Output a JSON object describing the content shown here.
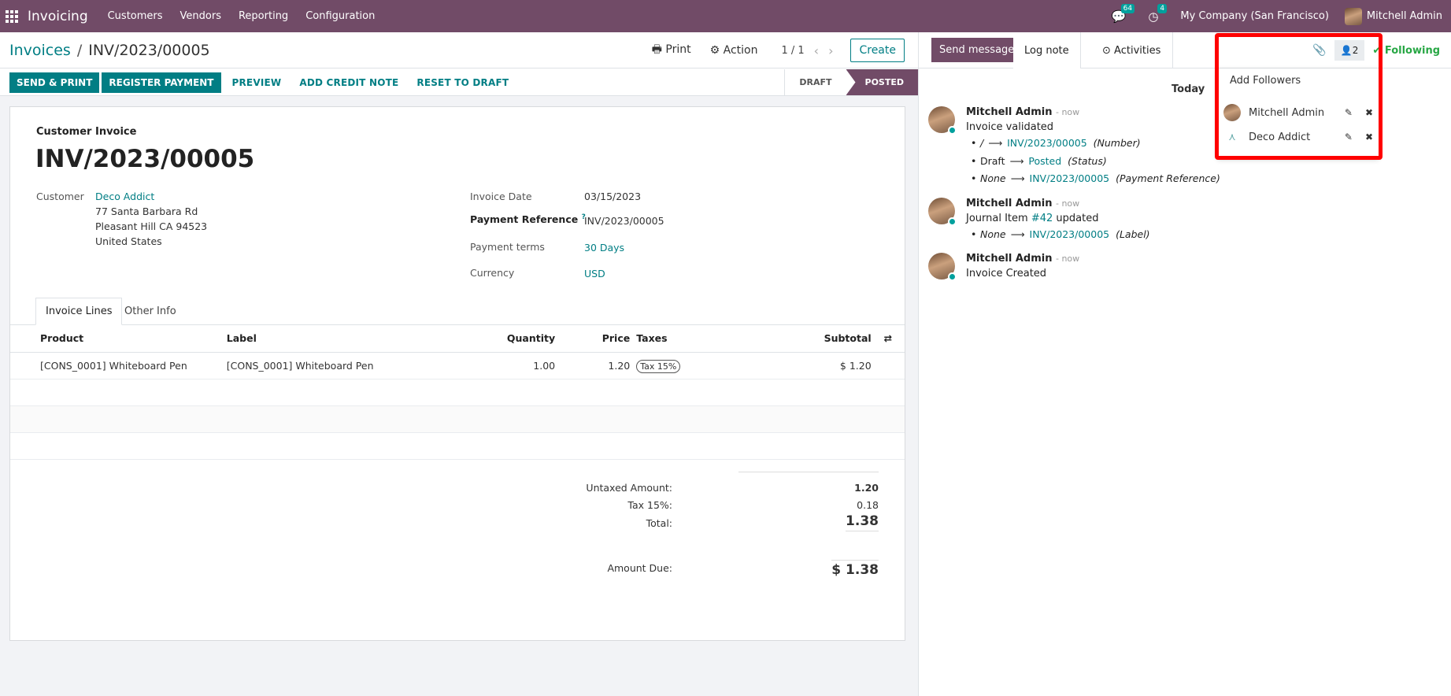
{
  "navbar": {
    "app_name": "Invoicing",
    "menu": [
      "Customers",
      "Vendors",
      "Reporting",
      "Configuration"
    ],
    "messages_count": "64",
    "activities_count": "4",
    "company": "My Company (San Francisco)",
    "user": "Mitchell Admin"
  },
  "control_panel": {
    "breadcrumb_parent": "Invoices",
    "breadcrumb_separator": "/",
    "breadcrumb_current": "INV/2023/00005",
    "print_label": "Print",
    "action_label": "Action",
    "pager": "1 / 1",
    "create_label": "Create"
  },
  "statusbar": {
    "send_print": "SEND & PRINT",
    "register_payment": "REGISTER PAYMENT",
    "preview": "PREVIEW",
    "add_credit_note": "ADD CREDIT NOTE",
    "reset_to_draft": "RESET TO DRAFT",
    "stages": [
      "DRAFT",
      "POSTED"
    ],
    "active_stage": "POSTED"
  },
  "invoice": {
    "type": "Customer Invoice",
    "number": "INV/2023/00005",
    "customer_label": "Customer",
    "customer_name": "Deco Addict",
    "address_line1": "77 Santa Barbara Rd",
    "address_line2": "Pleasant Hill CA 94523",
    "address_line3": "United States",
    "invoice_date_label": "Invoice Date",
    "invoice_date": "03/15/2023",
    "payment_ref_label": "Payment Reference",
    "payment_ref_help": "?",
    "payment_ref": "INV/2023/00005",
    "payment_terms_label": "Payment terms",
    "payment_terms": "30 Days",
    "currency_label": "Currency",
    "currency": "USD"
  },
  "tabs": {
    "invoice_lines": "Invoice Lines",
    "other_info": "Other Info"
  },
  "lines": {
    "headers": {
      "product": "Product",
      "label": "Label",
      "quantity": "Quantity",
      "price": "Price",
      "taxes": "Taxes",
      "subtotal": "Subtotal"
    },
    "rows": [
      {
        "product": "[CONS_0001] Whiteboard Pen",
        "label": "[CONS_0001] Whiteboard Pen",
        "quantity": "1.00",
        "price": "1.20",
        "tax": "Tax 15%",
        "subtotal": "$ 1.20"
      }
    ]
  },
  "totals": {
    "untaxed_label": "Untaxed Amount:",
    "untaxed": "1.20",
    "tax_label": "Tax 15%:",
    "tax": "0.18",
    "total_label": "Total:",
    "total": "1.38",
    "due_label": "Amount Due:",
    "due": "$ 1.38"
  },
  "chatter": {
    "send_message": "Send message",
    "log_note": "Log note",
    "activities": "Activities",
    "followers_count": "2",
    "following": "Following",
    "today": "Today",
    "messages": [
      {
        "author": "Mitchell Admin",
        "time": "- now",
        "body": "Invoice validated",
        "changes": [
          {
            "old": "/",
            "new": "INV/2023/00005",
            "field": "(Number)"
          },
          {
            "old": "Draft",
            "new": "Posted",
            "field": "(Status)"
          },
          {
            "old": "None",
            "new": "INV/2023/00005",
            "field": "(Payment Reference)"
          }
        ]
      },
      {
        "author": "Mitchell Admin",
        "time": "- now",
        "body_prefix": "Journal Item",
        "body_link": "#42",
        "body_suffix": "updated",
        "changes": [
          {
            "old": "None",
            "new": "INV/2023/00005",
            "field": "(Label)"
          }
        ]
      },
      {
        "author": "Mitchell Admin",
        "time": "- now",
        "body": "Invoice Created"
      }
    ]
  },
  "followers_dropdown": {
    "add_followers": "Add Followers",
    "followers": [
      "Mitchell Admin",
      "Deco Addict"
    ]
  },
  "colors": {
    "brand": "#714B67",
    "accent": "#017E84",
    "highlight": "#ff0000",
    "following": "#28a745"
  }
}
